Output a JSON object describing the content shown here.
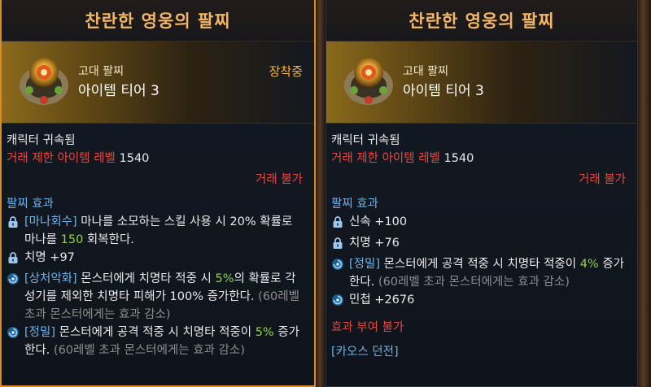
{
  "tooltips": [
    {
      "title": "찬란한 영웅의 팔찌",
      "grade": "고대 팔찌",
      "tier": "아이템 티어 3",
      "equipped": "장착중",
      "bound": "캐릭터 귀속됨",
      "trade_limit_label": "거래 제한 아이템 레벨",
      "trade_limit_value": "1540",
      "tradable": "거래 불가",
      "section_title": "팔찌 효과",
      "effects": [
        {
          "icon": "lock-icon",
          "parts": [
            [
              "[마나회수]",
              "blue"
            ],
            [
              " 마나를 소모하는 스킬 사용 시 20% 확률로 마나를 ",
              "white"
            ],
            [
              "150",
              "green"
            ],
            [
              " 회복한다.",
              "white"
            ]
          ]
        },
        {
          "icon": "lock-icon",
          "parts": [
            [
              "치명 +97",
              "white"
            ]
          ]
        },
        {
          "icon": "swirl-icon",
          "parts": [
            [
              "[상처악화]",
              "blue"
            ],
            [
              " 몬스터에게 치명타 적중 시 ",
              "white"
            ],
            [
              "5%",
              "green"
            ],
            [
              "의 확률로 각성기를 제외한 치명타 피해가 100% 증가한다. ",
              "white"
            ],
            [
              "(60레벨 초과 몬스터에게는 효과 감소)",
              "grey"
            ]
          ]
        },
        {
          "icon": "swirl-icon",
          "parts": [
            [
              "[정밀]",
              "blue"
            ],
            [
              " 몬스터에게 공격 적중 시 치명타 적중이 ",
              "white"
            ],
            [
              "5%",
              "green"
            ],
            [
              " 증가한다. ",
              "white"
            ],
            [
              "(60레벨 초과 몬스터에게는 효과 감소)",
              "grey"
            ]
          ]
        }
      ]
    },
    {
      "title": "찬란한 영웅의 팔찌",
      "grade": "고대 팔찌",
      "tier": "아이템 티어 3",
      "bound": "캐릭터 귀속됨",
      "trade_limit_label": "거래 제한 아이템 레벨",
      "trade_limit_value": "1540",
      "tradable": "거래 불가",
      "section_title": "팔찌 효과",
      "effects": [
        {
          "icon": "lock-icon",
          "parts": [
            [
              "신속 +100",
              "white"
            ]
          ]
        },
        {
          "icon": "lock-icon",
          "parts": [
            [
              "치명 +76",
              "white"
            ]
          ]
        },
        {
          "icon": "swirl-icon",
          "parts": [
            [
              "[정밀]",
              "blue"
            ],
            [
              " 몬스터에게 공격 적중 시 치명타 적중이 ",
              "white"
            ],
            [
              "4%",
              "green"
            ],
            [
              " 증가한다. ",
              "white"
            ],
            [
              "(60레벨 초과 몬스터에게는 효과 감소)",
              "grey"
            ]
          ]
        },
        {
          "icon": "swirl-icon",
          "parts": [
            [
              "민첩 +2676",
              "white"
            ]
          ]
        }
      ],
      "enchant_status": "효과 부여 불가",
      "chaos_dungeon": "[카오스 던전]"
    }
  ],
  "colors": {
    "title": "#f2b66a",
    "red": "#e2483f",
    "green": "#8fd24a",
    "blue": "#6fb2e6",
    "equipped": "#f3b52d",
    "selected_border": "#d98a2b"
  }
}
